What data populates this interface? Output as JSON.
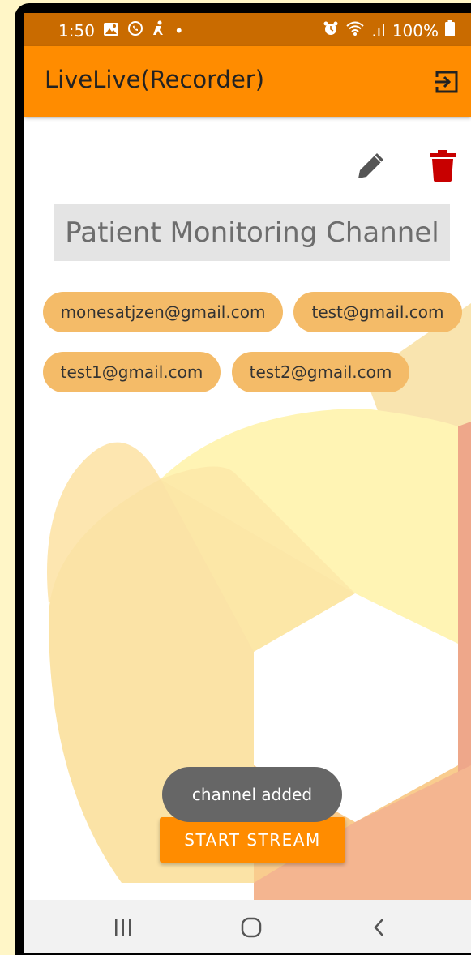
{
  "status_bar": {
    "time": "1:50",
    "dot": "•",
    "signal_label": ".ıl",
    "battery": "100%",
    "icons": [
      "gallery-icon",
      "whatsapp-icon",
      "figure-icon",
      "alarm-icon",
      "wifi-icon",
      "battery-icon"
    ]
  },
  "app_bar": {
    "title": "LiveLive(Recorder)",
    "action_icon": "exit-icon"
  },
  "channel": {
    "name": "Patient Monitoring Channel",
    "edit_icon": "pencil-icon",
    "delete_icon": "trash-icon"
  },
  "members": [
    "monesatjzen@gmail.com",
    "test@gmail.com",
    "test1@gmail.com",
    "test2@gmail.com"
  ],
  "toast": {
    "message": "channel added"
  },
  "actions": {
    "start_stream_label": "START STREAM"
  },
  "nav_bar": {
    "recents_icon": "recents-icon",
    "home_icon": "home-icon",
    "back_icon": "back-icon"
  },
  "colors": {
    "accent": "#ff8c00",
    "status_bar": "#c96b00",
    "chip": "#f4bb68",
    "delete": "#c80000",
    "toast": "#666666"
  }
}
